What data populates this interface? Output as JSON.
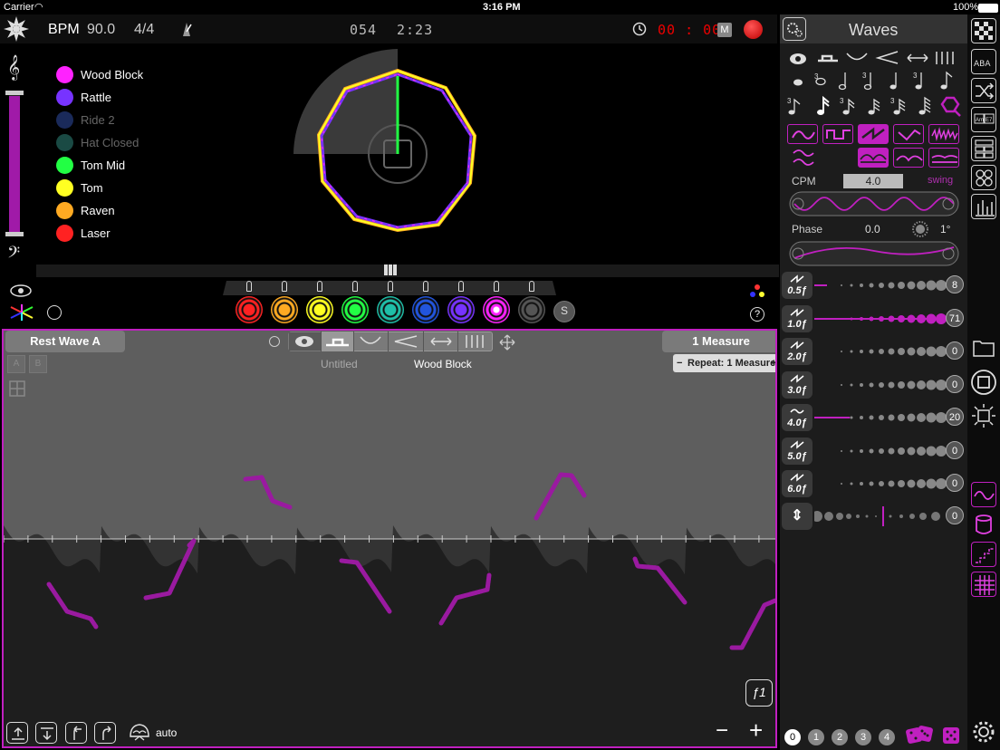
{
  "status": {
    "carrier": "Carrier",
    "time": "3:16 PM",
    "battery": "100%"
  },
  "transport": {
    "bpm_label": "BPM",
    "bpm_value": "90.0",
    "time_sig": "4/4",
    "counter": "054",
    "clock": "2:23",
    "timer": "00 : 00",
    "m_button": "M"
  },
  "legend": [
    {
      "label": "Wood Block",
      "color": "#ff22ff",
      "active": true
    },
    {
      "label": "Rattle",
      "color": "#7733ff",
      "active": true
    },
    {
      "label": "Ride 2",
      "color": "#1a2a5a",
      "active": false
    },
    {
      "label": "Hat Closed",
      "color": "#1a4a44",
      "active": false
    },
    {
      "label": "Tom Mid",
      "color": "#22ff44",
      "active": true
    },
    {
      "label": "Tom",
      "color": "#ffff22",
      "active": true
    },
    {
      "label": "Raven",
      "color": "#ffaa22",
      "active": true
    },
    {
      "label": "Laser",
      "color": "#ff2222",
      "active": true
    }
  ],
  "pads": [
    {
      "color": "#ff2222"
    },
    {
      "color": "#ffaa22"
    },
    {
      "color": "#ffff22"
    },
    {
      "color": "#22ff44"
    },
    {
      "color": "#1fbfa8"
    },
    {
      "color": "#2255dd"
    },
    {
      "color": "#7733ff"
    },
    {
      "color": "#ff22ff"
    },
    {
      "color": "#555555"
    }
  ],
  "pad_s_label": "S",
  "help_label": "?",
  "editor": {
    "rest_button": "Rest Wave A",
    "tab_a": "A",
    "tab_b": "B",
    "pattern_name": "Untitled",
    "instrument_name": "Wood Block",
    "measure_label": "1 Measure",
    "repeat_label": "Repeat: 1 Measure",
    "repeat_minus": "−",
    "repeat_plus": "+",
    "f1_label": "ƒ1",
    "auto_label": "auto",
    "zoom_minus": "−",
    "zoom_plus": "+"
  },
  "waves_panel": {
    "title": "Waves",
    "cpm_label": "CPM",
    "cpm_value": "4.0",
    "swing_label": "swing",
    "phase_label": "Phase",
    "phase_value": "0.0",
    "phase_deg": "1°",
    "harmonics": [
      {
        "label": "0.5ƒ",
        "value": "8",
        "level": 0.1
      },
      {
        "label": "1.0ƒ",
        "value": "71",
        "level": 1.0
      },
      {
        "label": "2.0ƒ",
        "value": "0",
        "level": 0
      },
      {
        "label": "3.0ƒ",
        "value": "0",
        "level": 0
      },
      {
        "label": "4.0ƒ",
        "value": "20",
        "level": 0.28
      },
      {
        "label": "5.0ƒ",
        "value": "0",
        "level": 0
      },
      {
        "label": "6.0ƒ",
        "value": "0",
        "level": 0
      }
    ],
    "shift_value": "0",
    "bottom_numbers": [
      "0",
      "1",
      "2",
      "3",
      "4"
    ]
  },
  "colors": {
    "accent": "#c020c0",
    "rec": "#e02020"
  }
}
